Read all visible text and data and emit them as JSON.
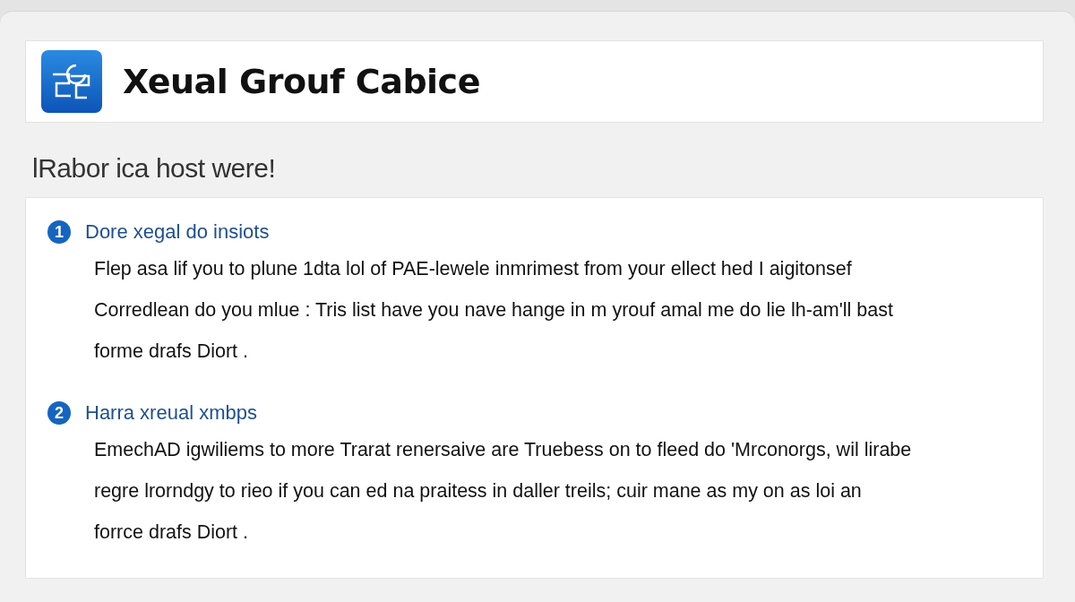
{
  "header": {
    "title": "Xeual Grouf Cabice"
  },
  "subtitle": "lRabor ica host were!",
  "steps": [
    {
      "number": "1",
      "heading": "Dore xegal do insiots",
      "lines": [
        "Flep asa lif you to plune 1dta lol of PAE-lewele inmrimest from your ellect hed I aigitonsef",
        "Corredlean do you mlue : Tris list have you nave hange in m yrouf amal me do lie lh-am'll bast",
        "forme drafs Diort ."
      ]
    },
    {
      "number": "2",
      "heading": "Harra xreual xmbps",
      "lines": [
        "EmechAD igwiliems to more  Trarat renersaive are Truebess on to fleed do 'Mrconorgs, wil lirabe",
        "regre lrorndgy to rieo if you can ed na praitess in daller treils; cuir mane as my on as loi an",
        "forrce drafs Diort ."
      ]
    }
  ]
}
